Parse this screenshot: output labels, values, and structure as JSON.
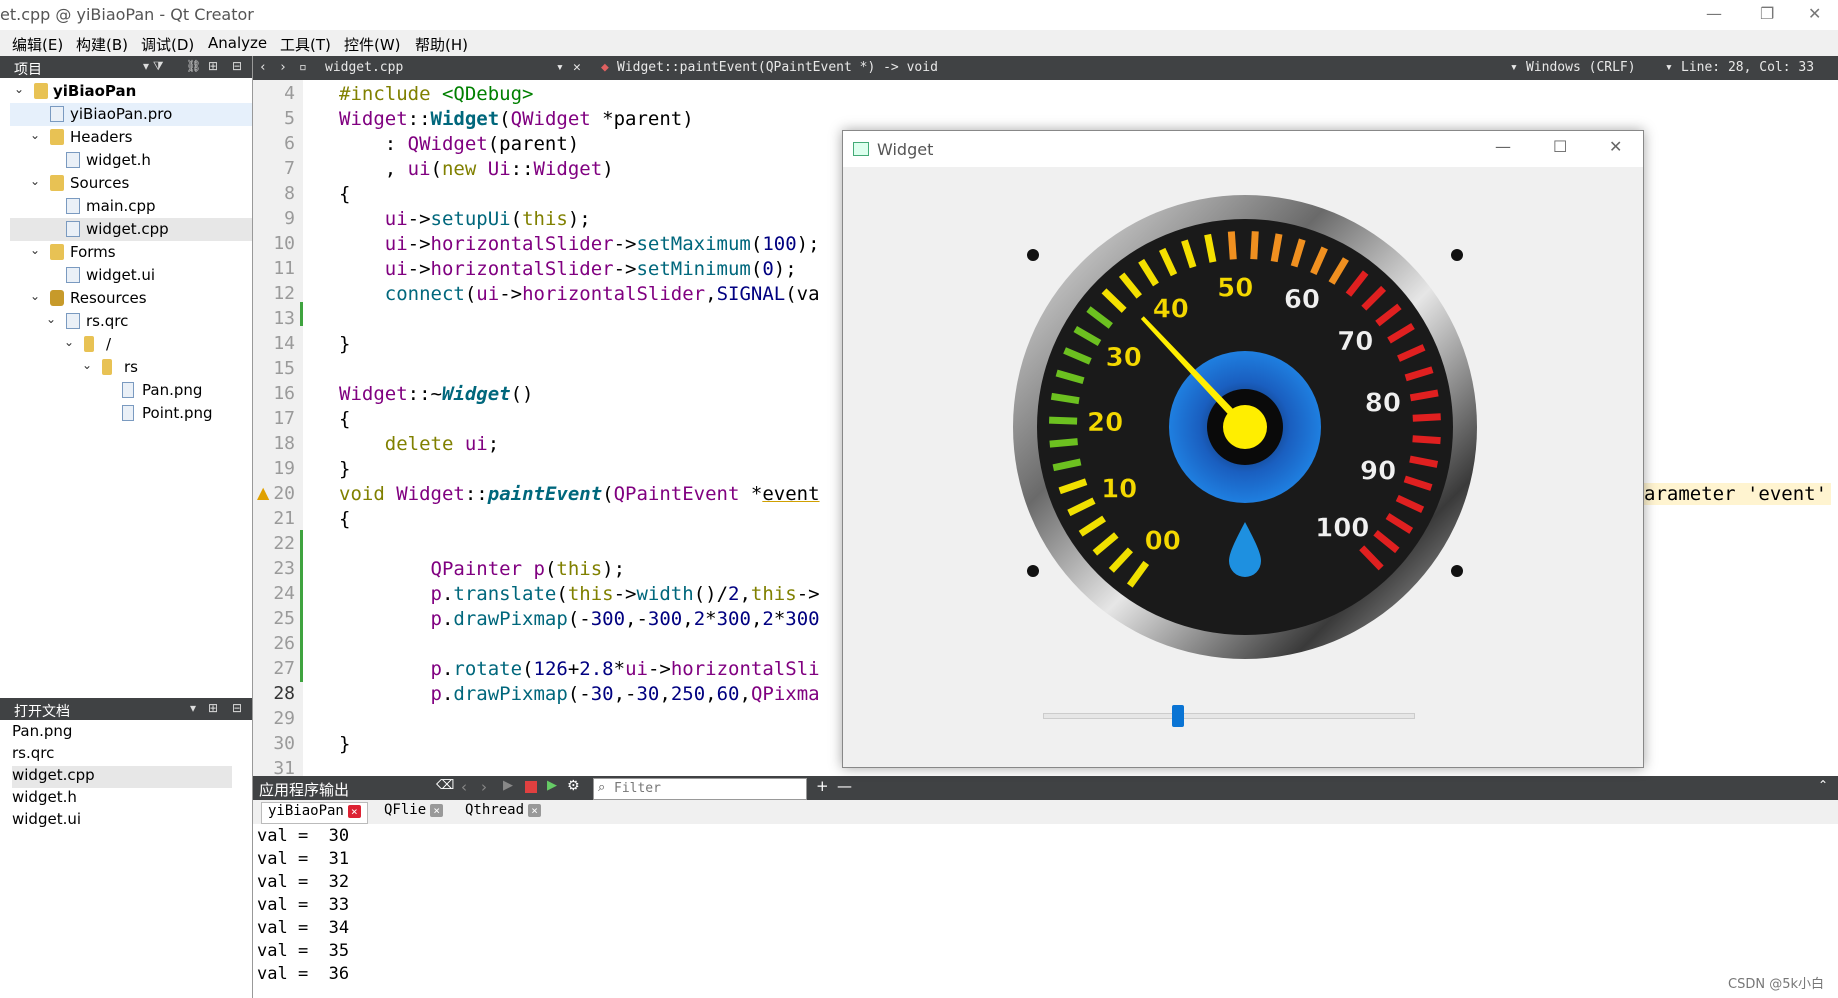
{
  "window": {
    "title": "et.cpp @ yiBiaoPan - Qt Creator",
    "min": "—",
    "restore": "❐",
    "close": "✕"
  },
  "menu": [
    "编辑(E)",
    "构建(B)",
    "调试(D)",
    "Analyze",
    "工具(T)",
    "控件(W)",
    "帮助(H)"
  ],
  "project_pane": {
    "title": "项目",
    "tree": [
      {
        "label": "yiBiaoPan",
        "depth": 0,
        "icon": "project-icon",
        "expanded": true,
        "bold": true
      },
      {
        "label": "yiBiaoPan.pro",
        "depth": 1,
        "icon": "pro-file-icon",
        "highlight": true
      },
      {
        "label": "Headers",
        "depth": 1,
        "icon": "folder-icon",
        "expanded": true
      },
      {
        "label": "widget.h",
        "depth": 2,
        "icon": "header-file-icon"
      },
      {
        "label": "Sources",
        "depth": 1,
        "icon": "folder-icon",
        "expanded": true
      },
      {
        "label": "main.cpp",
        "depth": 2,
        "icon": "cpp-file-icon"
      },
      {
        "label": "widget.cpp",
        "depth": 2,
        "icon": "cpp-file-icon",
        "selected": true
      },
      {
        "label": "Forms",
        "depth": 1,
        "icon": "folder-icon",
        "expanded": true
      },
      {
        "label": "widget.ui",
        "depth": 2,
        "icon": "ui-file-icon"
      },
      {
        "label": "Resources",
        "depth": 1,
        "icon": "folder-icon",
        "expanded": true
      },
      {
        "label": "rs.qrc",
        "depth": 2,
        "icon": "qrc-file-icon",
        "expanded": true
      },
      {
        "label": "/",
        "depth": 3,
        "icon": "folder-icon",
        "expanded": true
      },
      {
        "label": "rs",
        "depth": 4,
        "icon": "folder-icon",
        "expanded": true
      },
      {
        "label": "Pan.png",
        "depth": 5,
        "icon": "image-file-icon"
      },
      {
        "label": "Point.png",
        "depth": 5,
        "icon": "image-file-icon"
      }
    ]
  },
  "open_docs": {
    "title": "打开文档",
    "items": [
      "Pan.png",
      "rs.qrc",
      "widget.cpp",
      "widget.h",
      "widget.ui"
    ],
    "selected": "widget.cpp"
  },
  "editor": {
    "file": "widget.cpp",
    "function": "Widget::paintEvent(QPaintEvent *) -> void",
    "line_ending": "Windows (CRLF)",
    "position": "Line: 28, Col: 33",
    "line_numbers": [
      "4",
      "5",
      "6",
      "7",
      "8",
      "9",
      "10",
      "11",
      "12",
      "13",
      "14",
      "15",
      "16",
      "17",
      "18",
      "19",
      "20",
      "21",
      "22",
      "23",
      "24",
      "25",
      "26",
      "27",
      "28",
      "29",
      "30",
      "31"
    ],
    "warning_tail": "arameter 'event'"
  },
  "output": {
    "title": "应用程序输出",
    "filter_placeholder": "Filter",
    "tabs": [
      "yiBiaoPan",
      "QFlie",
      "Qthread"
    ],
    "lines": [
      "val =  30",
      "val =  31",
      "val =  32",
      "val =  33",
      "val =  34",
      "val =  35",
      "val =  36"
    ]
  },
  "widget_window": {
    "title": "Widget",
    "gauge_labels": [
      "00",
      "10",
      "20",
      "30",
      "40",
      "50",
      "60",
      "70",
      "80",
      "90",
      "100"
    ],
    "slider_value": 36,
    "slider_min": 0,
    "slider_max": 100
  },
  "watermark": "CSDN @5k小白"
}
